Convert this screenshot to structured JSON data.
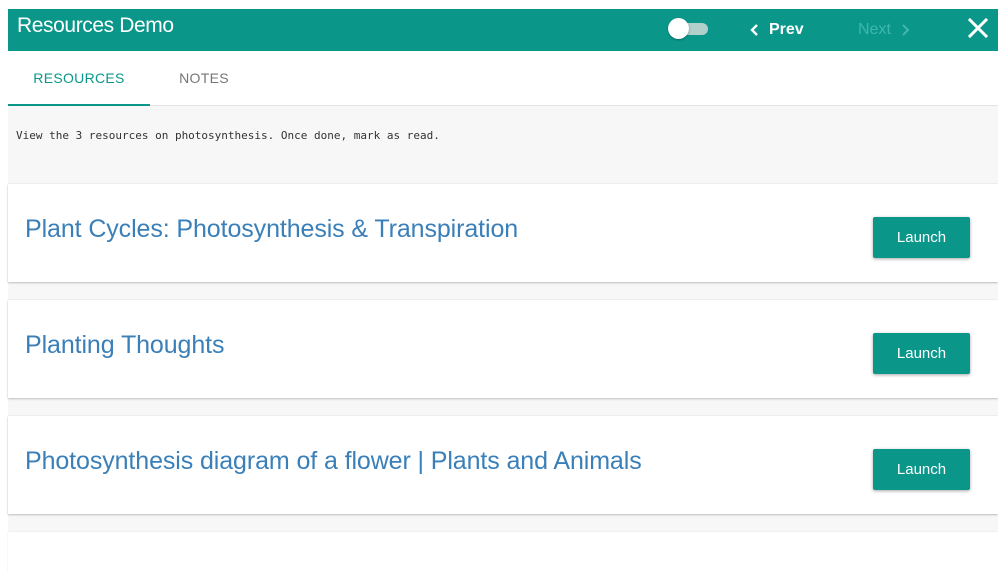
{
  "header": {
    "title": "Resources Demo",
    "prev_label": "Prev",
    "next_label": "Next",
    "toggle_state": "off",
    "accent_color": "#0a978a"
  },
  "tabs": [
    {
      "label": "RESOURCES",
      "active": true
    },
    {
      "label": "NOTES",
      "active": false
    }
  ],
  "instructions": "View the 3 resources on photosynthesis. Once done, mark as read.",
  "resources": [
    {
      "title": "Plant Cycles: Photosynthesis & Transpiration",
      "button_label": "Launch"
    },
    {
      "title": "Planting Thoughts",
      "button_label": "Launch"
    },
    {
      "title": "Photosynthesis diagram of a flower | Plants and Animals",
      "button_label": "Launch"
    }
  ],
  "icons": {
    "prev": "chevron-left-icon",
    "next": "chevron-right-icon",
    "close": "close-icon"
  }
}
